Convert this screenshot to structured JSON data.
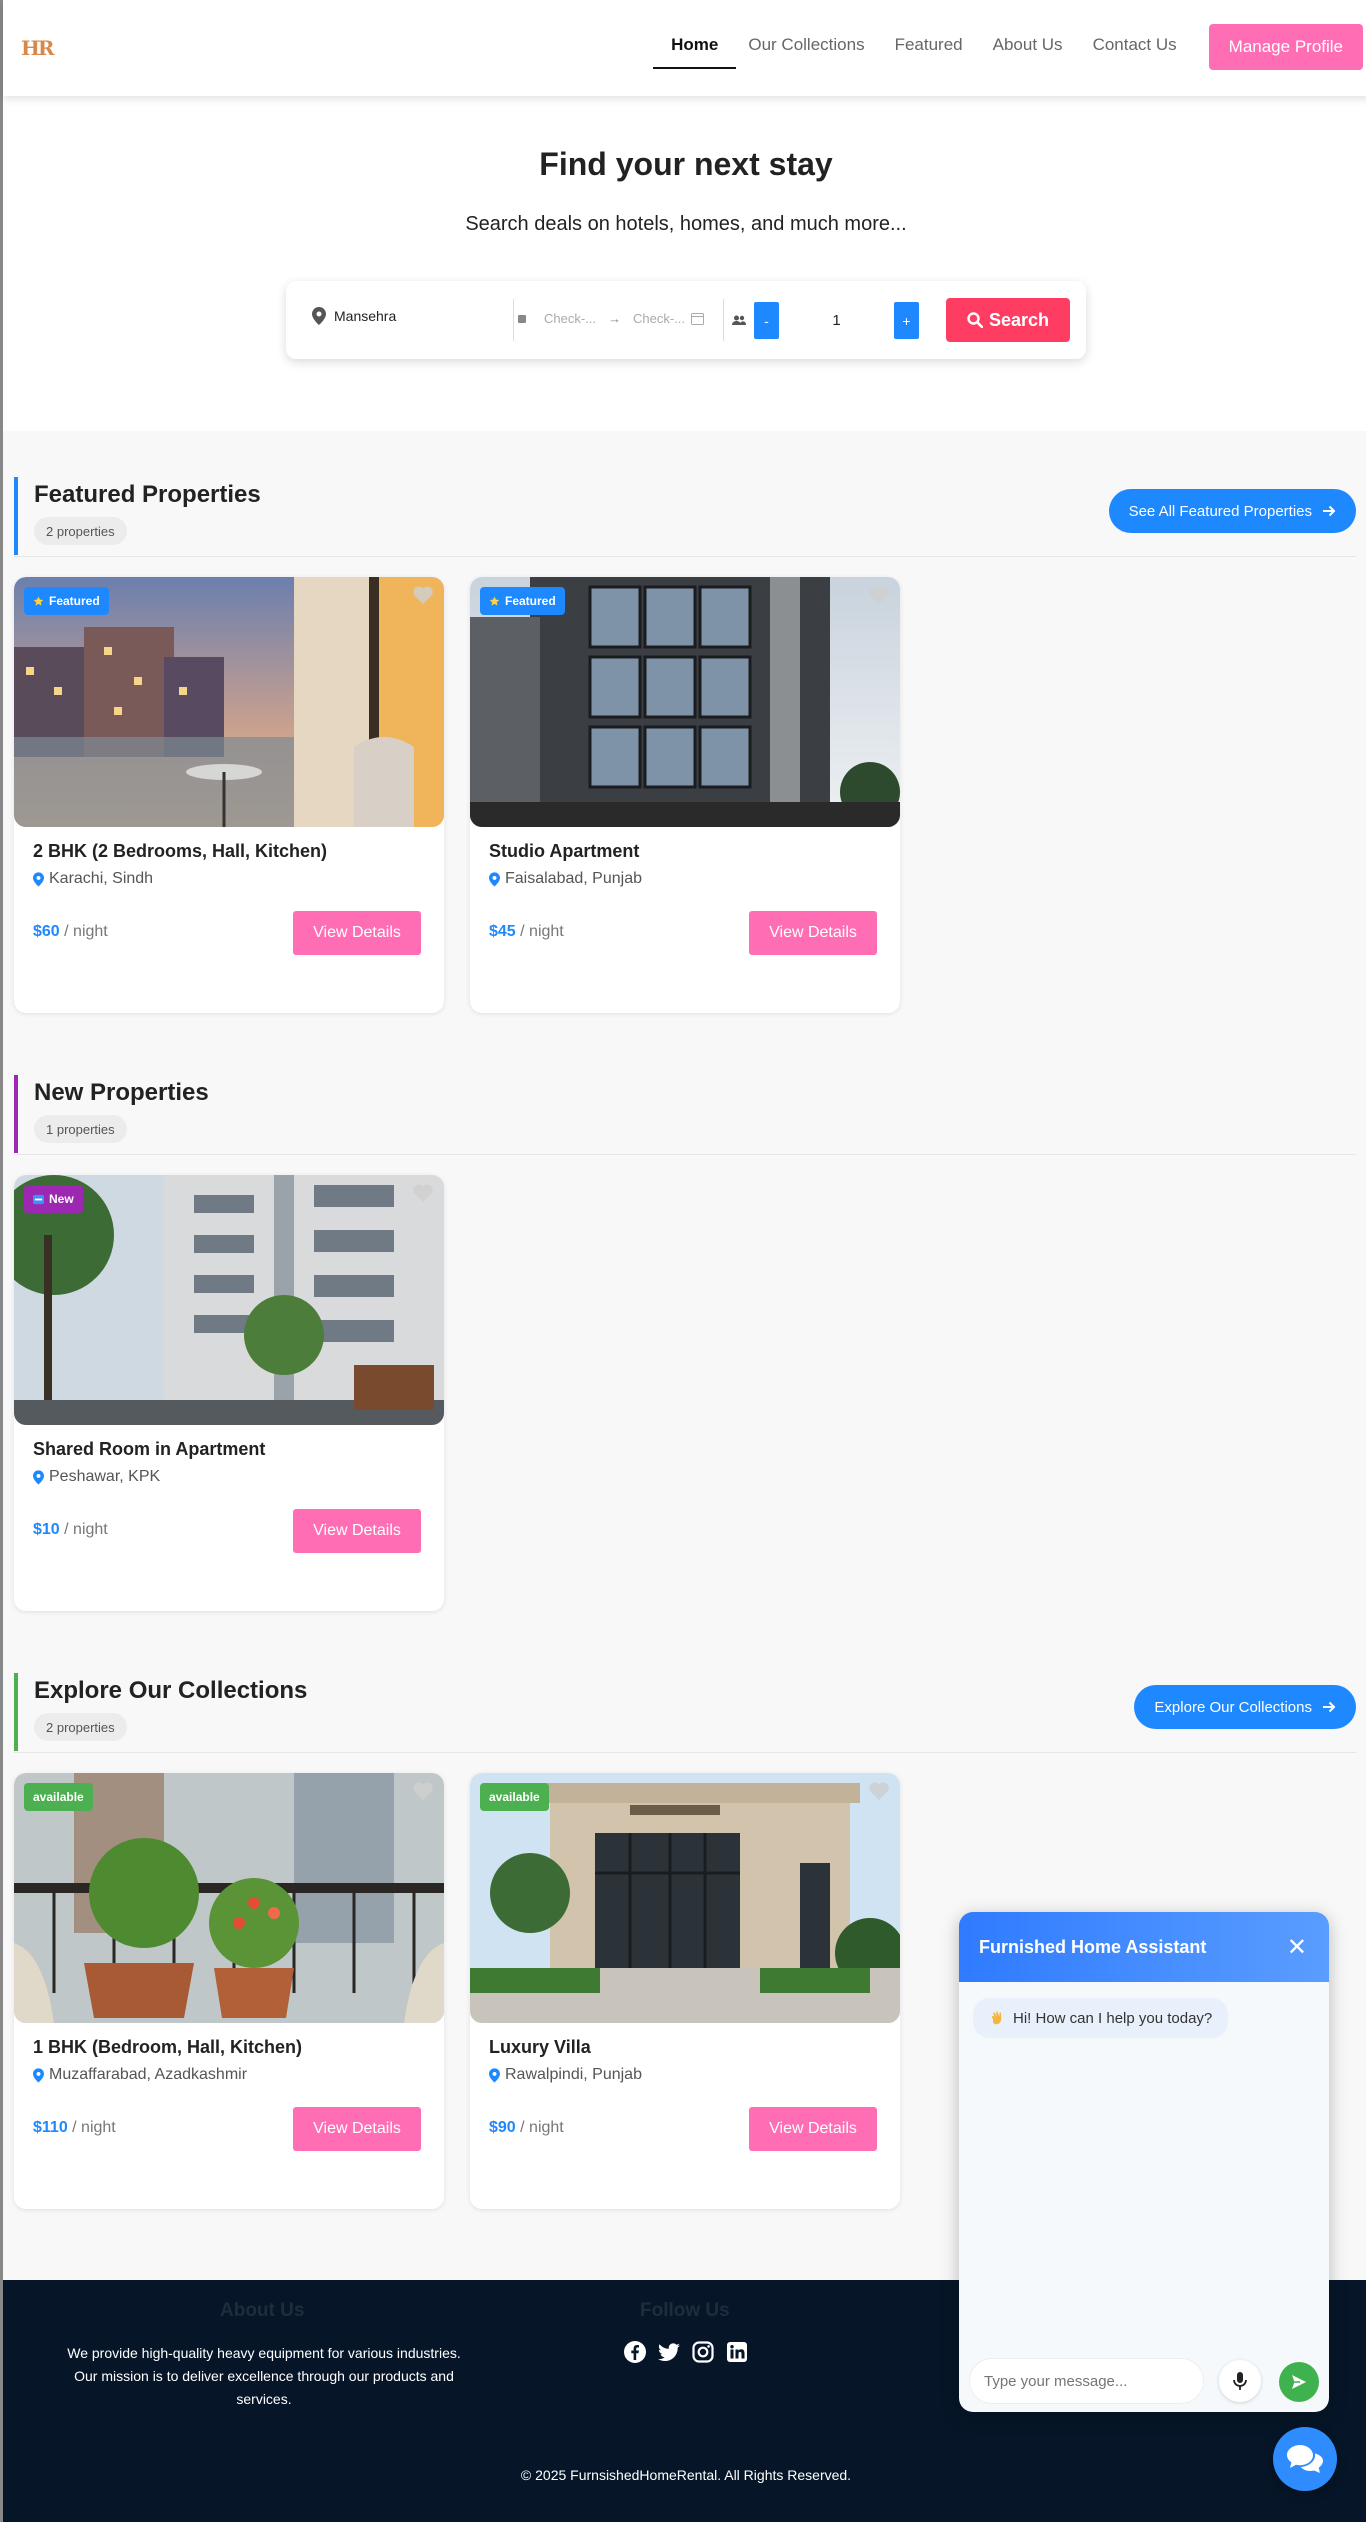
{
  "nav": {
    "logo": "HR",
    "links": [
      "Home",
      "Our Collections",
      "Featured",
      "About Us",
      "Contact Us"
    ],
    "manage_label": "Manage Profile"
  },
  "hero": {
    "title": "Find your next stay",
    "subtitle": "Search deals on hotels, homes, and much more...",
    "location_value": "Mansehra",
    "checkin_placeholder": "Check-...",
    "checkout_placeholder": "Check-...",
    "guests_minus": "-",
    "guests_value": "1",
    "guests_plus": "+",
    "search_label": "Search"
  },
  "sections": {
    "featured": {
      "title": "Featured Properties",
      "count": "2 properties",
      "button": "See All Featured Properties",
      "accent": "#1e88ff",
      "cards": [
        {
          "badge": "Featured",
          "title": "2 BHK (2 Bedrooms, Hall, Kitchen)",
          "location": "Karachi, Sindh",
          "price": "$60",
          "unit": " / night",
          "button": "View Details"
        },
        {
          "badge": "Featured",
          "title": "Studio Apartment",
          "location": "Faisalabad, Punjab",
          "price": "$45",
          "unit": " / night",
          "button": "View Details"
        }
      ]
    },
    "new": {
      "title": "New Properties",
      "count": "1 properties",
      "accent": "#9c27b0",
      "cards": [
        {
          "badge": "New",
          "title": "Shared Room in Apartment",
          "location": "Peshawar, KPK",
          "price": "$10",
          "unit": " / night",
          "button": "View Details"
        }
      ]
    },
    "collections": {
      "title": "Explore Our Collections",
      "count": "2 properties",
      "button": "Explore Our Collections",
      "accent": "#4caf50",
      "cards": [
        {
          "badge": "available",
          "title": "1 BHK (Bedroom, Hall, Kitchen)",
          "location": "Muzaffarabad, Azadkashmir",
          "price": "$110",
          "unit": " / night",
          "button": "View Details"
        },
        {
          "badge": "available",
          "title": "Luxury Villa",
          "location": "Rawalpindi, Punjab",
          "price": "$90",
          "unit": " / night",
          "button": "View Details"
        }
      ]
    }
  },
  "footer": {
    "about_title": "About Us",
    "about_text": "We provide high-quality heavy equipment for various industries. Our mission is to deliver excellence through our products and services.",
    "follow_title": "Follow Us",
    "social_icons": [
      "facebook-icon",
      "twitter-icon",
      "instagram-icon",
      "linkedin-icon"
    ],
    "copyright": "© 2025 FurnsishedHomeRental. All Rights Reserved."
  },
  "chat": {
    "title": "Furnished Home Assistant",
    "close": "✕",
    "greeting": "Hi! How can I help you today?",
    "input_placeholder": "Type your message..."
  },
  "colors": {
    "primary": "#1e88ff",
    "pink": "#ff6eb4",
    "search_red": "#ff3d63",
    "footer_bg": "#061628",
    "new_purple": "#9c27b0",
    "available_green": "#4caf50"
  }
}
